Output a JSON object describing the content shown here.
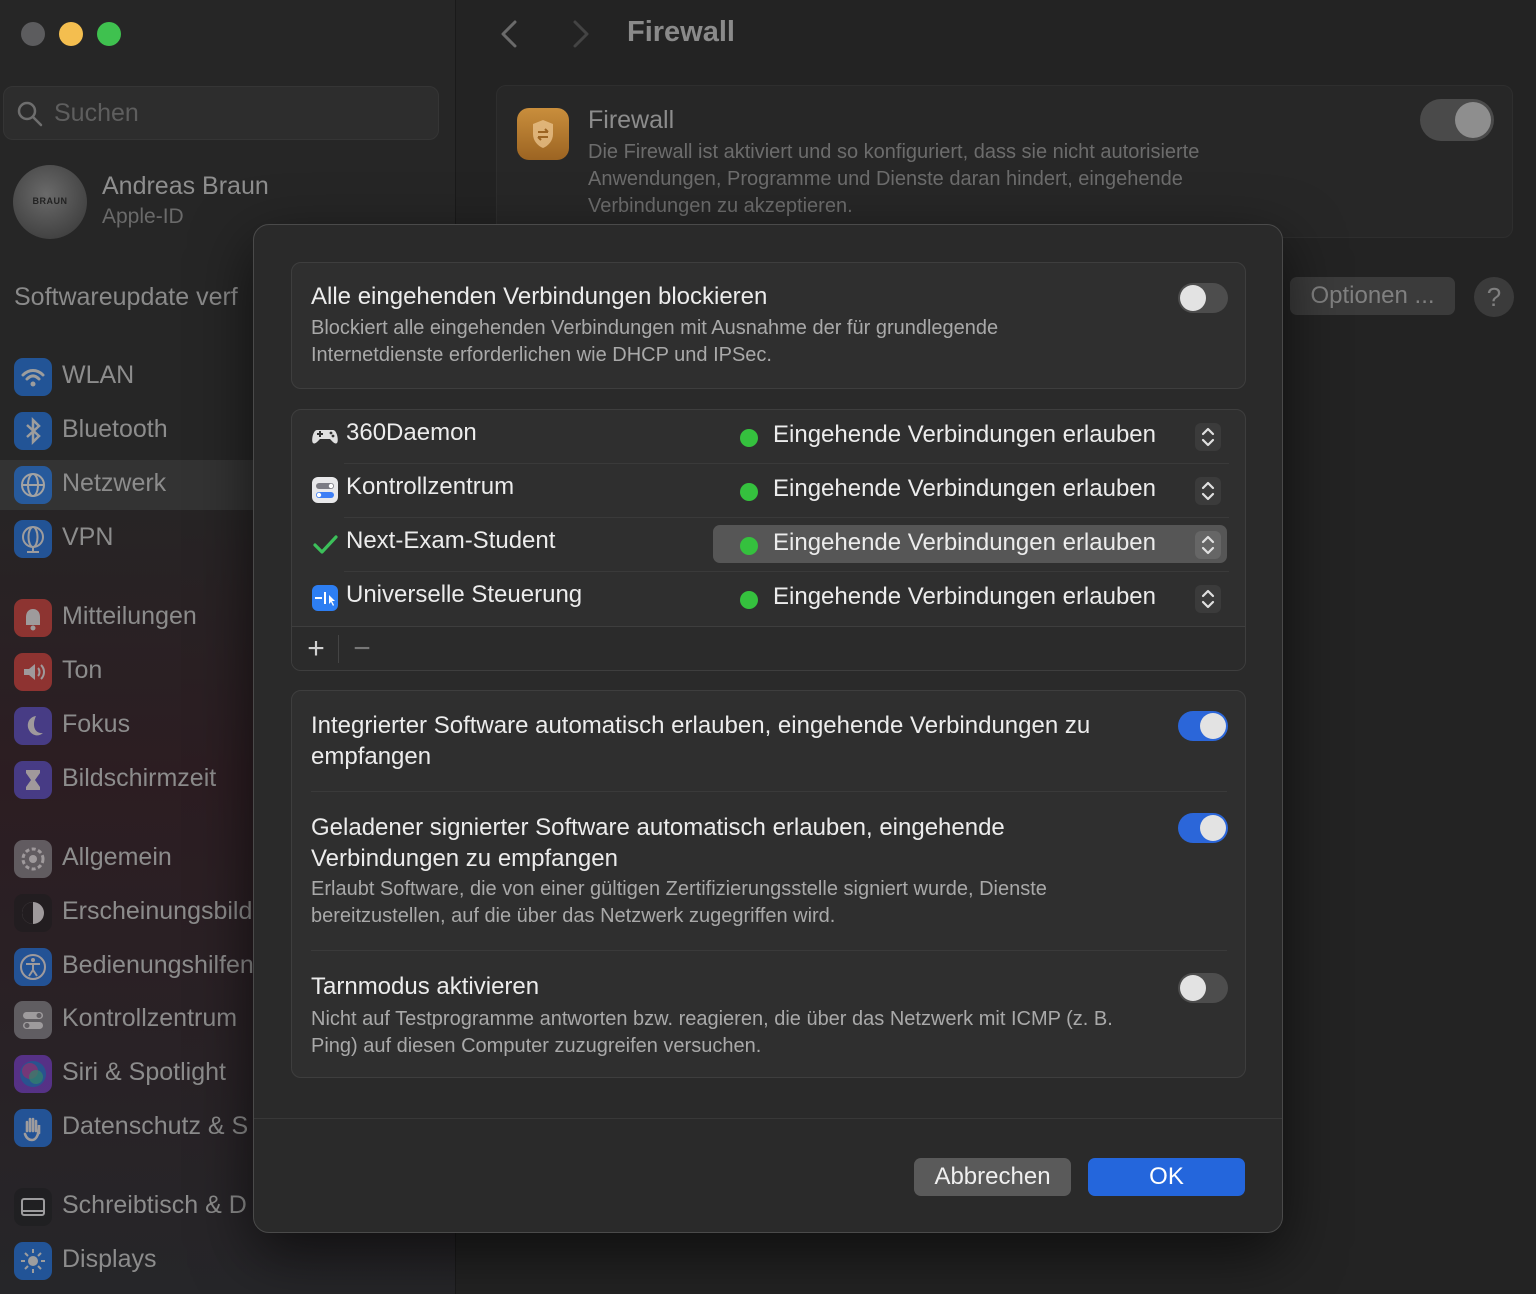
{
  "window": {
    "title": "Firewall"
  },
  "sidebar": {
    "search_placeholder": "Suchen",
    "user": {
      "name": "Andreas Braun",
      "subtitle": "Apple-ID",
      "avatar_text": "BRAUN"
    },
    "update_text": "Softwareupdate verf",
    "items": [
      {
        "label": "WLAN",
        "icon": "wifi-icon",
        "color": "#1f7bf2"
      },
      {
        "label": "Bluetooth",
        "icon": "bluetooth-icon",
        "color": "#1f7bf2"
      },
      {
        "label": "Netzwerk",
        "icon": "globe-icon",
        "color": "#1f7bf2",
        "selected": true
      },
      {
        "label": "VPN",
        "icon": "vpn-globe-icon",
        "color": "#1f7bf2"
      },
      {
        "label": "Mitteilungen",
        "icon": "bell-icon",
        "color": "#e0443d"
      },
      {
        "label": "Ton",
        "icon": "speaker-icon",
        "color": "#e0443d"
      },
      {
        "label": "Fokus",
        "icon": "moon-icon",
        "color": "#5e55d6"
      },
      {
        "label": "Bildschirmzeit",
        "icon": "hourglass-icon",
        "color": "#5e55d6"
      },
      {
        "label": "Allgemein",
        "icon": "gear-icon",
        "color": "#8e8e93"
      },
      {
        "label": "Erscheinungsbild",
        "icon": "appearance-icon",
        "color": "#1c1c1e"
      },
      {
        "label": "Bedienungshilfen",
        "icon": "accessibility-icon",
        "color": "#1f7bf2"
      },
      {
        "label": "Kontrollzentrum",
        "icon": "control-center-icon",
        "color": "#8e8e93"
      },
      {
        "label": "Siri & Spotlight",
        "icon": "siri-icon",
        "color": "#7b3fd6"
      },
      {
        "label": "Datenschutz & S",
        "icon": "hand-icon",
        "color": "#1f7bf2"
      },
      {
        "label": "Schreibtisch & D",
        "icon": "desktop-icon",
        "color": "#1c1c1e"
      },
      {
        "label": "Displays",
        "icon": "sun-icon",
        "color": "#1f7bf2"
      }
    ]
  },
  "main": {
    "title": "Firewall",
    "card": {
      "title": "Firewall",
      "description": "Die Firewall ist aktiviert und so konfiguriert, dass sie nicht autorisierte Anwendungen, Programme und Dienste daran hindert, eingehende Verbindungen zu akzeptieren.",
      "enabled": true
    },
    "options_label": "Optionen ...",
    "help_label": "?"
  },
  "sheet": {
    "block_all": {
      "title": "Alle eingehenden Verbindungen blockieren",
      "description": "Blockiert alle eingehenden Verbindungen mit Ausnahme der für grundlegende Internetdienste erforderlichen wie DHCP und IPSec.",
      "enabled": false
    },
    "apps": [
      {
        "name": "360Daemon",
        "icon": "gamepad-icon",
        "status": "Eingehende Verbindungen erlauben",
        "status_color": "#35c13e",
        "active": false
      },
      {
        "name": "Kontrollzentrum",
        "icon": "control-center-app-icon",
        "status": "Eingehende Verbindungen erlauben",
        "status_color": "#35c13e",
        "active": false
      },
      {
        "name": "Next-Exam-Student",
        "icon": "checkmark-icon",
        "status": "Eingehende Verbindungen erlauben",
        "status_color": "#35c13e",
        "active": true
      },
      {
        "name": "Universelle Steuerung",
        "icon": "universal-control-icon",
        "status": "Eingehende Verbindungen erlauben",
        "status_color": "#35c13e",
        "active": false
      }
    ],
    "add_label": "+",
    "remove_label": "−",
    "options": [
      {
        "title": "Integrierter Software automatisch erlauben, eingehende Verbindungen zu empfangen",
        "description": "",
        "enabled": true
      },
      {
        "title": "Geladener signierter Software automatisch erlauben, eingehende Verbindungen zu empfangen",
        "description": "Erlaubt Software, die von einer gültigen Zertifizierungsstelle signiert wurde, Dienste bereitzustellen, auf die über das Netzwerk zugegriffen wird.",
        "enabled": true
      },
      {
        "title": "Tarnmodus aktivieren",
        "description": "Nicht auf Testprogramme antworten bzw. reagieren, die über das Netzwerk mit ICMP (z. B. Ping) auf diesen Computer zuzugreifen versuchen.",
        "enabled": false
      }
    ],
    "cancel_label": "Abbrechen",
    "ok_label": "OK"
  }
}
